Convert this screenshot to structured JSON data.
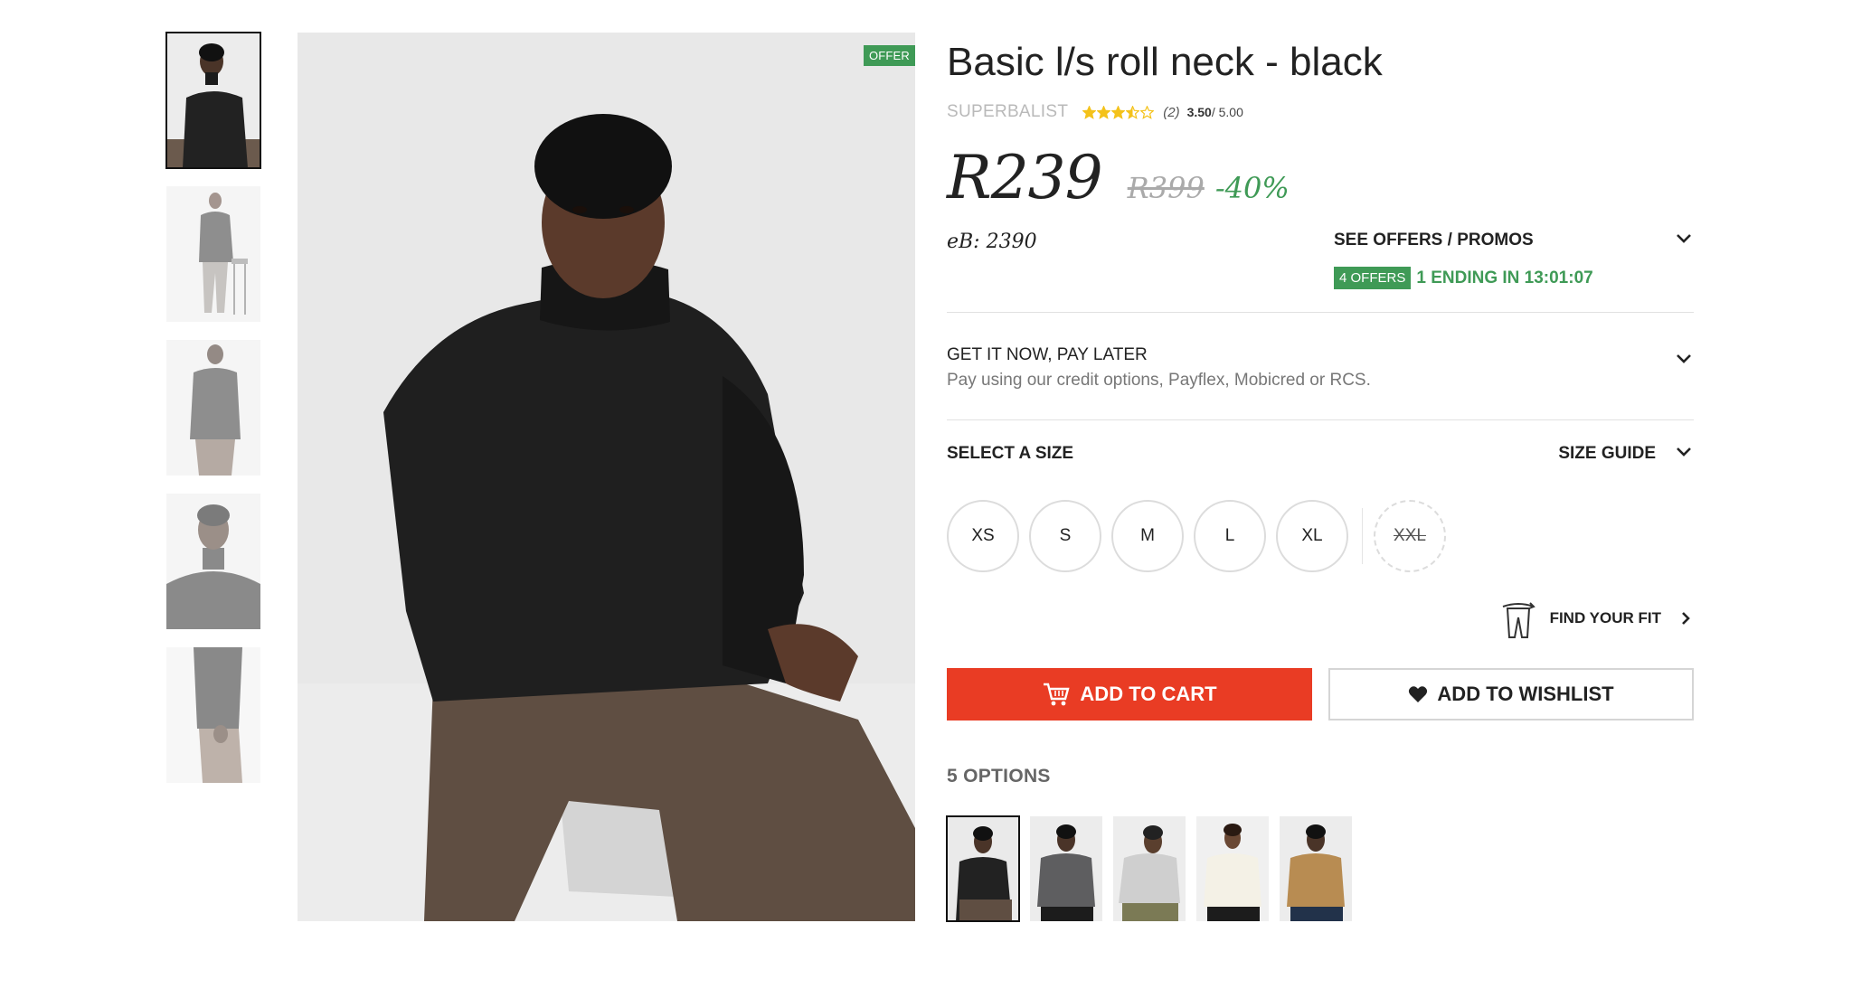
{
  "product": {
    "title": "Basic l/s roll neck - black",
    "brand": "SUPERBALIST",
    "rating_value": "3.50",
    "rating_max": "/ 5.00",
    "review_count": "(2)",
    "stars_filled": 3.5,
    "stars_total": 5
  },
  "price": {
    "current": "R239",
    "original": "R399",
    "discount": "-40%",
    "ebucks": "eB: 2390"
  },
  "offers": {
    "title": "SEE OFFERS / PROMOS",
    "count_badge": "4 OFFERS",
    "ending": "1 ENDING IN 13:01:07"
  },
  "paylater": {
    "title": "GET IT NOW, PAY LATER",
    "subtitle": "Pay using our credit options, Payflex, Mobicred or RCS."
  },
  "sizes": {
    "label": "SELECT A SIZE",
    "guide": "SIZE GUIDE",
    "options": [
      "XS",
      "S",
      "M",
      "L",
      "XL"
    ],
    "unavailable": "XXL"
  },
  "fit": {
    "label": "FIND YOUR FIT"
  },
  "actions": {
    "cart": "ADD TO CART",
    "wishlist": "ADD TO WISHLIST"
  },
  "image": {
    "offer_badge": "OFFER"
  },
  "options": {
    "title": "5 OPTIONS",
    "swatches": [
      "black",
      "charcoal",
      "light-grey",
      "cream",
      "camel"
    ]
  },
  "colors": {
    "accent_green": "#3f9a56",
    "cart_red": "#e93c24",
    "star_yellow": "#f4c21a"
  }
}
